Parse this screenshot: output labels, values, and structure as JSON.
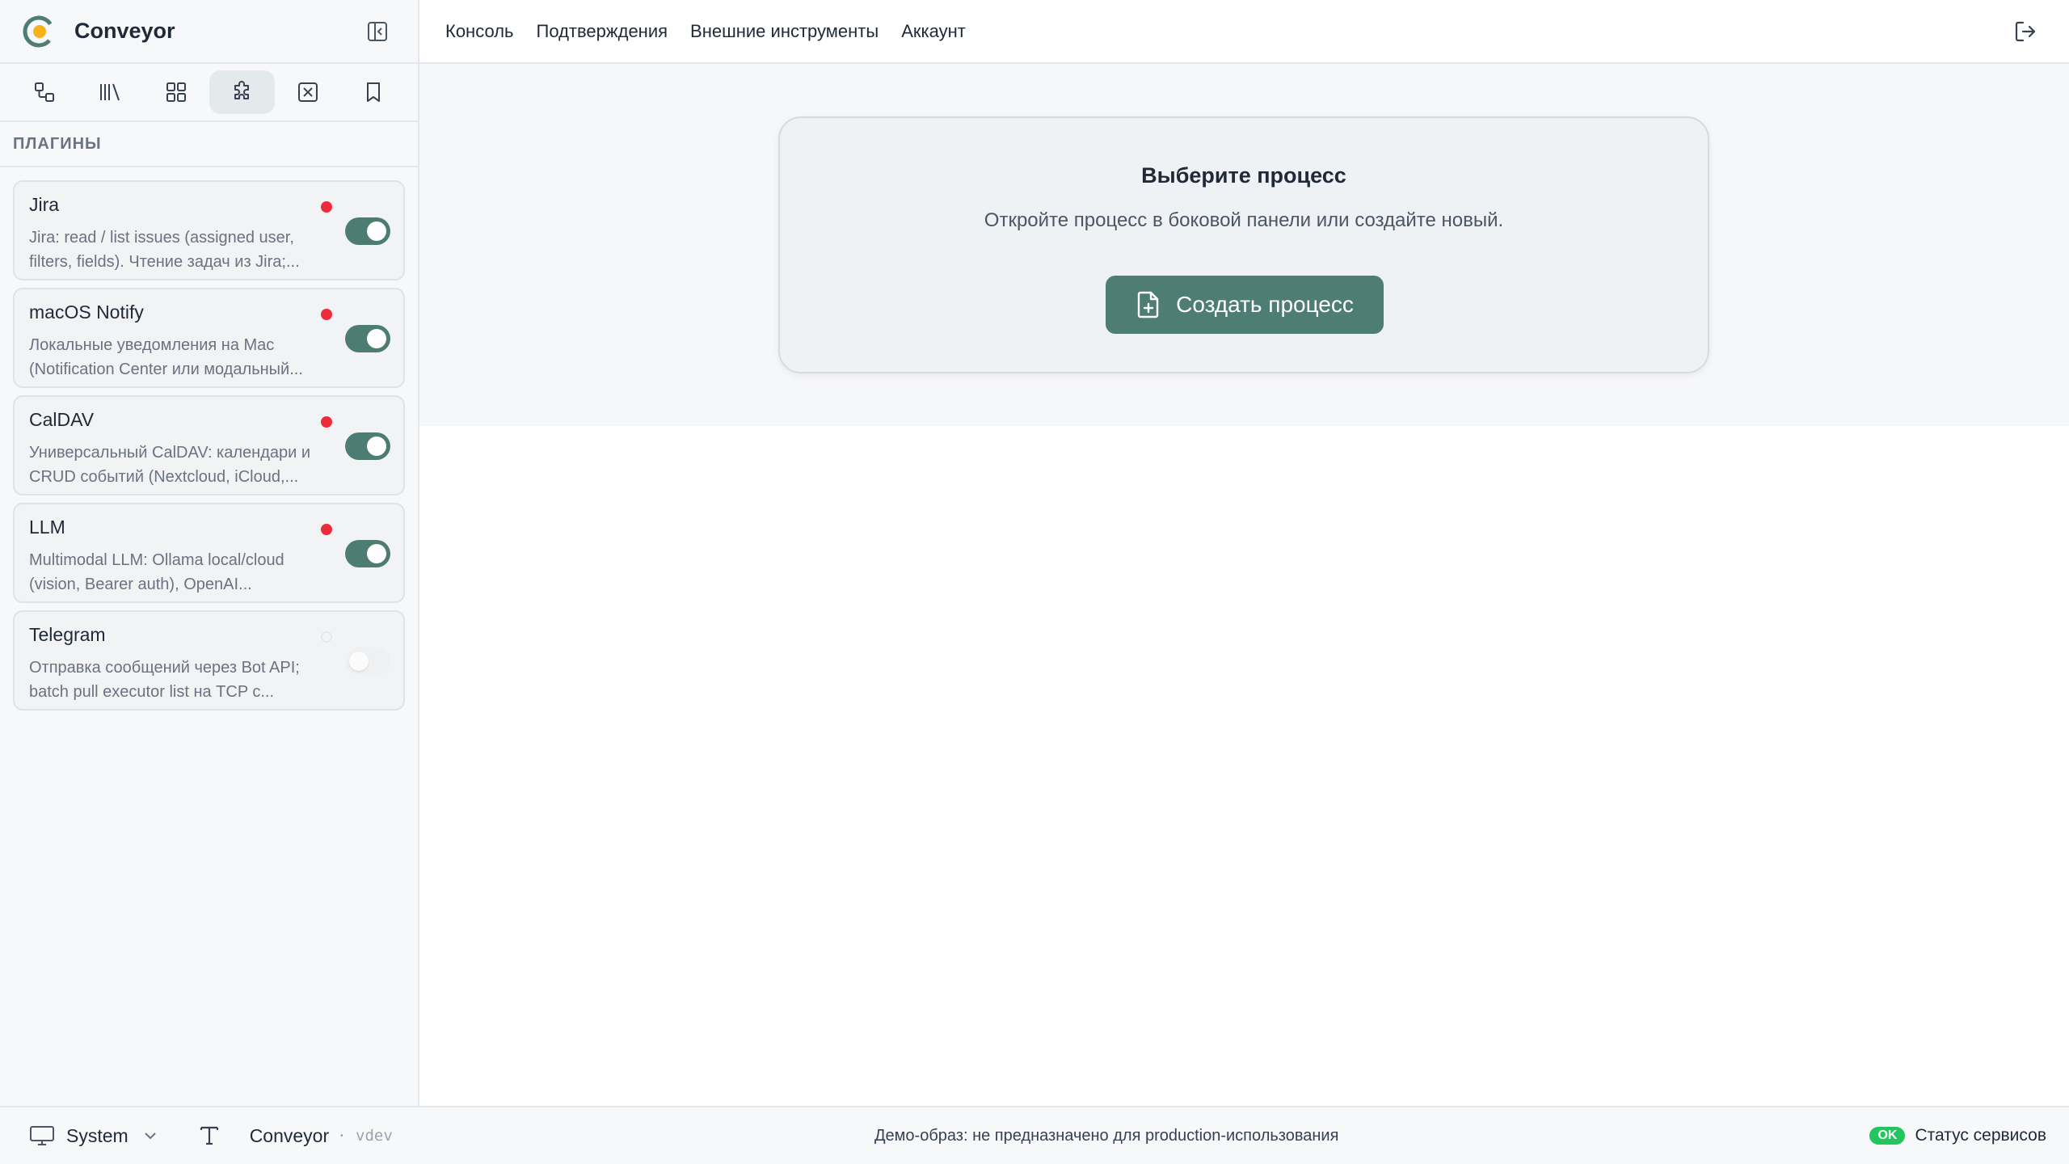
{
  "app": {
    "title": "Conveyor"
  },
  "sidebar": {
    "section_title": "ПЛАГИНЫ",
    "tabs": [
      {
        "icon": "flow-icon"
      },
      {
        "icon": "library-icon"
      },
      {
        "icon": "grid-icon"
      },
      {
        "icon": "puzzle-icon",
        "active": true
      },
      {
        "icon": "x-square-icon"
      },
      {
        "icon": "bookmark-icon"
      }
    ],
    "plugins": [
      {
        "name": "Jira",
        "description": "Jira: read / list issues (assigned user, filters, fields). Чтение задач из Jira;...",
        "status": "error",
        "enabled": true
      },
      {
        "name": "macOS Notify",
        "description": "Локальные уведомления на Mac (Notification Center или модальный...",
        "status": "error",
        "enabled": true
      },
      {
        "name": "CalDAV",
        "description": "Универсальный CalDAV: календари и CRUD событий (Nextcloud, iCloud,...",
        "status": "error",
        "enabled": true
      },
      {
        "name": "LLM",
        "description": "Multimodal LLM: Ollama local/cloud (vision, Bearer auth), OpenAI...",
        "status": "error",
        "enabled": true
      },
      {
        "name": "Telegram",
        "description": "Отправка сообщений через Bot API; batch pull executor list на TCP с...",
        "status": "off",
        "enabled": false
      }
    ]
  },
  "topnav": {
    "links": [
      "Консоль",
      "Подтверждения",
      "Внешние инструменты",
      "Аккаунт"
    ]
  },
  "main": {
    "card_title": "Выберите процесс",
    "card_subtitle": "Откройте процесс в боковой панели или создайте новый.",
    "create_button": "Создать процесс"
  },
  "footer": {
    "theme": "System",
    "brand": "Conveyor",
    "version": "· vdev",
    "demo_note": "Демо-образ: не предназначено для production-использования",
    "ok_badge": "OK",
    "services_label": "Статус сервисов"
  },
  "colors": {
    "accent": "#4e7d73",
    "error_dot": "#ef2a3a",
    "ok": "#22c55e"
  }
}
